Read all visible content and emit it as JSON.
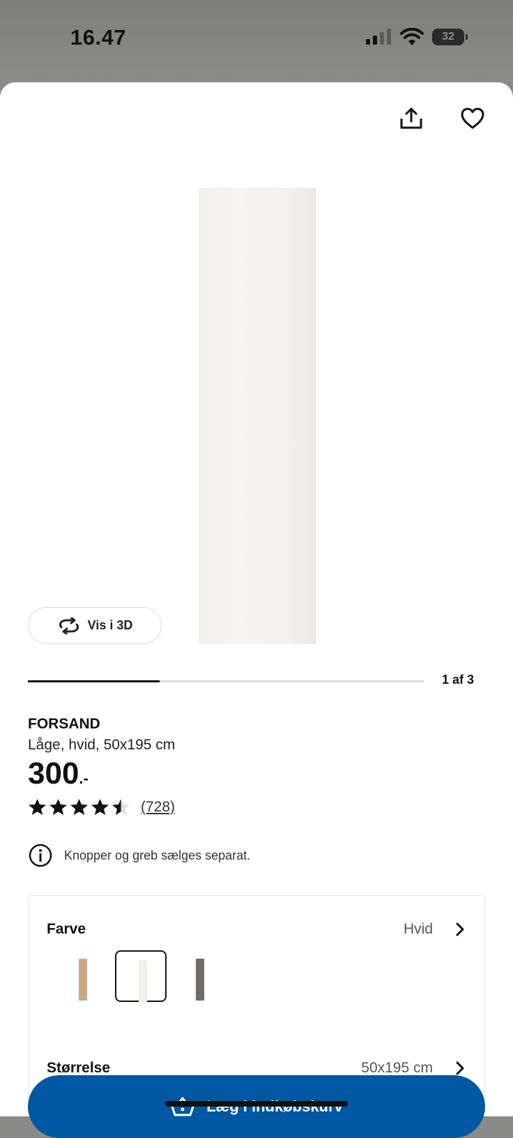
{
  "status_bar": {
    "time": "16.47",
    "battery": "32"
  },
  "product": {
    "name": "FORSAND",
    "description": "Låge, hvid, 50x195 cm",
    "price_main": "300",
    "price_suffix": ".-",
    "rating_stars": 4.5,
    "rating_max": 5,
    "review_count": "(728)",
    "note": "Knopper og greb sælges separat."
  },
  "gallery": {
    "view_3d_label": "Vis i 3D",
    "position_label": "1 af 3",
    "current": 1,
    "total": 3
  },
  "options": {
    "color": {
      "label": "Farve",
      "value": "Hvid",
      "swatches": [
        {
          "name": "oak",
          "color": "#c9a98a",
          "selected": false
        },
        {
          "name": "white",
          "color": "#f0efe9",
          "selected": true
        },
        {
          "name": "grey",
          "color": "#6e6b68",
          "selected": false
        }
      ]
    },
    "size": {
      "label": "Størrelse",
      "value": "50x195 cm"
    }
  },
  "cart_button": {
    "label": "Læg i indkøbskurv"
  },
  "colors": {
    "accent": "#0058a3"
  }
}
